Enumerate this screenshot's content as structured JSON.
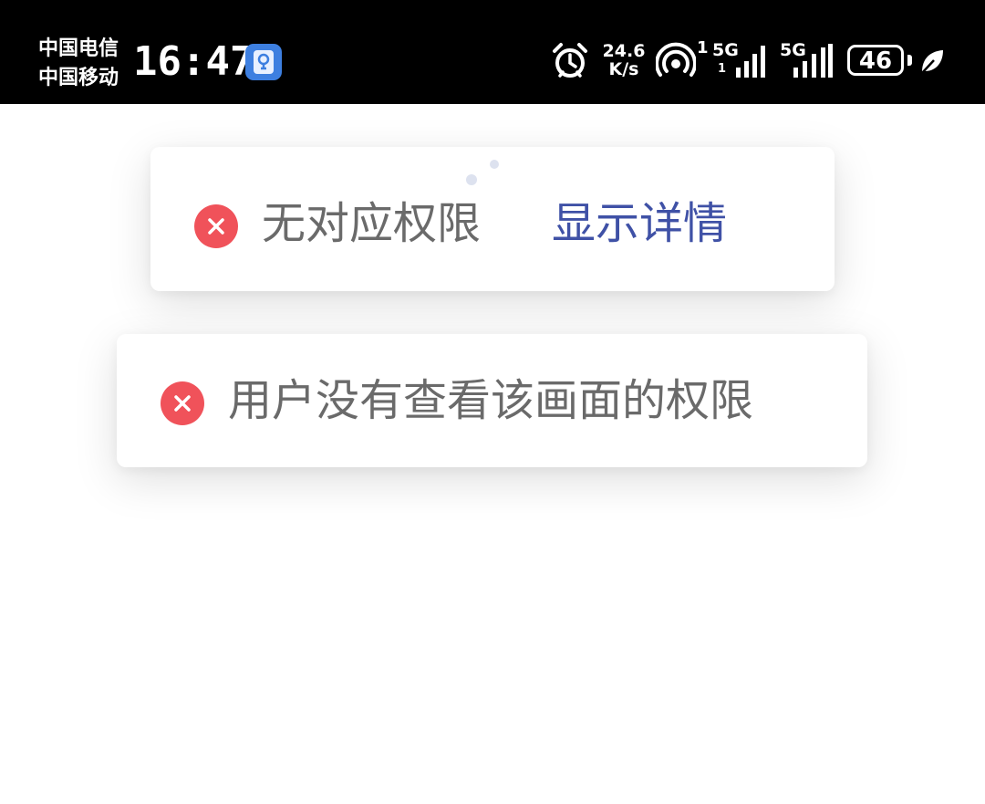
{
  "status_bar": {
    "carrier_1": "中国电信",
    "carrier_2": "中国移动",
    "time": "16:47",
    "net_speed_value": "24.6",
    "net_speed_unit": "K/s",
    "hotspot_count": "1",
    "signal_1_label": "5G",
    "signal_1_sub": "1",
    "signal_2_label": "5G",
    "battery_level": "46",
    "icons": [
      "app-icon",
      "alarm-icon",
      "hotspot-icon",
      "signal-icon",
      "battery-icon",
      "leaf-icon"
    ]
  },
  "toasts": [
    {
      "message": "无对应权限",
      "link_label": "显示详情",
      "icon": "error-icon"
    },
    {
      "message": "用户没有查看该画面的权限",
      "icon": "error-icon"
    }
  ],
  "colors": {
    "error": "#f0525a",
    "link": "#3f51a6",
    "text": "#6a6a6a",
    "status_bar_bg": "#000000"
  }
}
